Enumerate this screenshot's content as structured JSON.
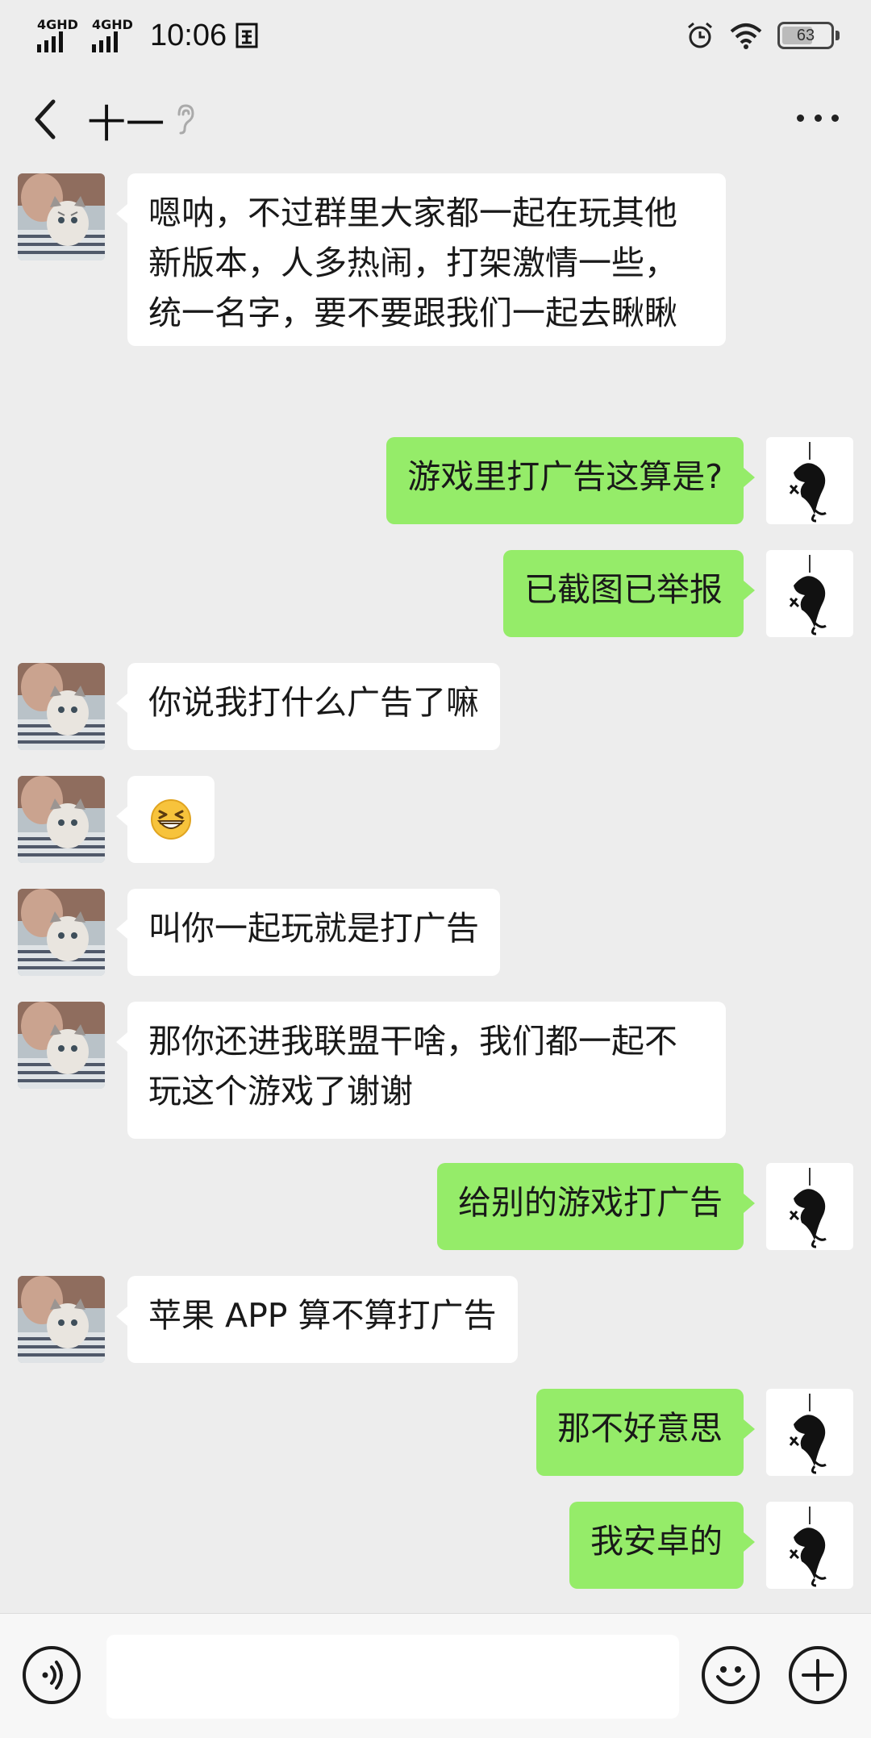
{
  "status": {
    "network1": "4GHD",
    "network2": "4GHD",
    "time": "10:06",
    "battery": "63"
  },
  "header": {
    "title": "十一"
  },
  "messages": [
    {
      "side": "left",
      "text": "嗯呐，不过群里大家都一起在玩其他新版本，人多热闹，打架激情一些，统一名字，要不要跟我们一起去瞅瞅"
    },
    {
      "side": "right",
      "text": "游戏里打广告这算是?"
    },
    {
      "side": "right",
      "text": "已截图已举报"
    },
    {
      "side": "left",
      "text": "你说我打什么广告了嘛"
    },
    {
      "side": "left",
      "text": "😆",
      "emoji": "grinning-squint-emoji"
    },
    {
      "side": "left",
      "text": "叫你一起玩就是打广告"
    },
    {
      "side": "left",
      "text": "那你还进我联盟干啥，我们都一起不玩这个游戏了谢谢"
    },
    {
      "side": "right",
      "text": "给别的游戏打广告"
    },
    {
      "side": "left",
      "text": "苹果 APP 算不算打广告"
    },
    {
      "side": "right",
      "text": "那不好意思"
    },
    {
      "side": "right",
      "text": "我安卓的"
    }
  ],
  "input": {
    "value": "",
    "placeholder": ""
  },
  "colors": {
    "background": "#ededed",
    "sent_bubble": "#95ec69",
    "received_bubble": "#ffffff"
  }
}
